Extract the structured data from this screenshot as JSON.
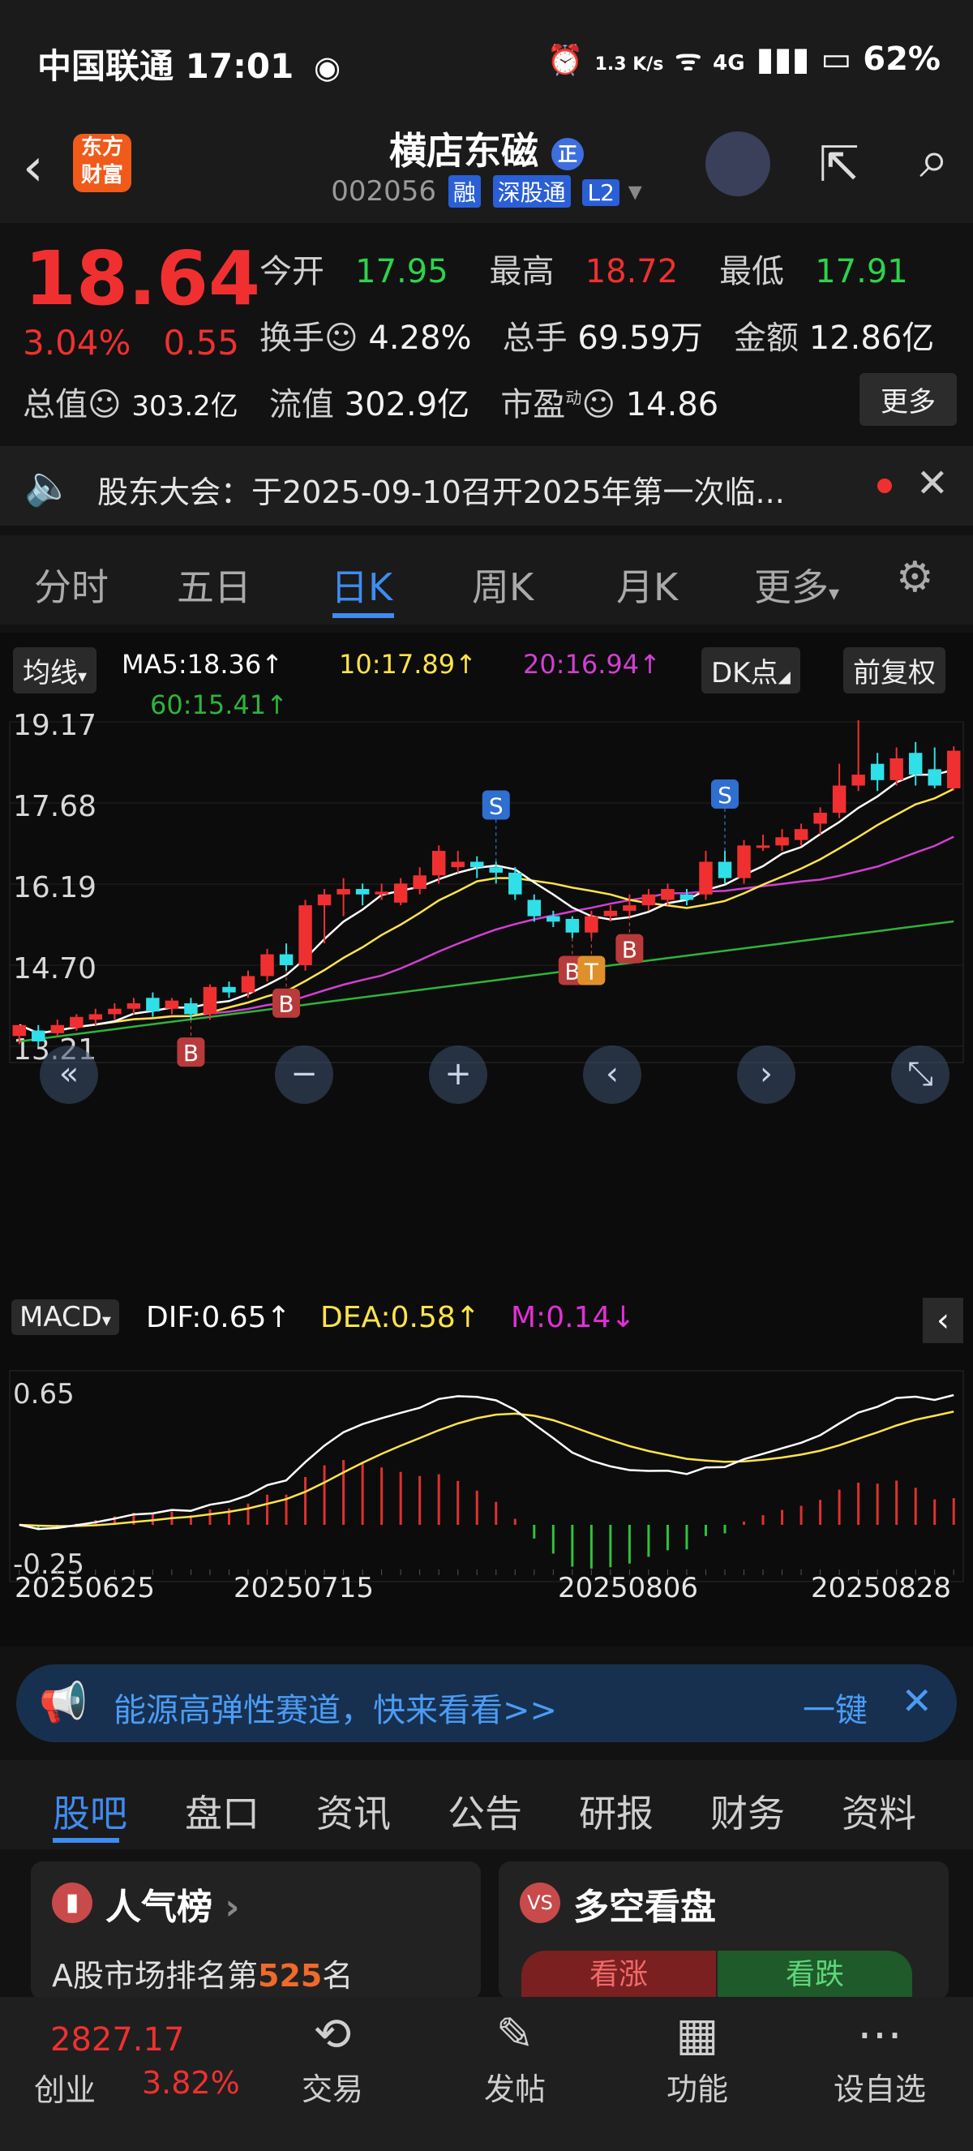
{
  "status": {
    "carrier": "中国联通",
    "time": "17:01",
    "net_speed": "1.3 K/s",
    "net_type": "4G",
    "battery": "62%"
  },
  "header": {
    "name": "横店东磁",
    "badge": "正",
    "code": "002056",
    "tags": [
      "融",
      "深股通",
      "L2"
    ],
    "logo_text": "东方财富"
  },
  "quote": {
    "price": "18.64",
    "pct": "3.04%",
    "change": "0.55",
    "open_label": "今开",
    "open": "17.95",
    "high_label": "最高",
    "high": "18.72",
    "low_label": "最低",
    "low": "17.91",
    "turnover_label": "换手",
    "turnover": "4.28%",
    "volume_label": "总手",
    "volume": "69.59万",
    "amount_label": "金额",
    "amount": "12.86亿",
    "total_cap_label": "总值",
    "total_cap": "303.2亿",
    "float_cap_label": "流值",
    "float_cap": "302.9亿",
    "pe_label": "市盈",
    "pe_sup": "动",
    "pe": "14.86",
    "more": "更多"
  },
  "notice": {
    "text": "股东大会：于2025-09-10召开2025年第一次临..."
  },
  "ktabs": [
    "分时",
    "五日",
    "日K",
    "周K",
    "月K",
    "更多"
  ],
  "ktab_active": 2,
  "chart_controls": {
    "ma_button": "均线",
    "dk_button": "DK点",
    "adjust_button": "前复权",
    "macd_button": "MACD"
  },
  "ma_legend": {
    "ma5": "MA5:18.36↑",
    "ma10": "10:17.89↑",
    "ma20": "20:16.94↑",
    "ma60": "60:15.41↑"
  },
  "macd_legend": {
    "dif": "DIF:0.65↑",
    "dea": "DEA:0.58↑",
    "m": "M:0.14↓"
  },
  "colors": {
    "up": "#f03030",
    "down": "#2fe0e8",
    "ma5": "#ffffff",
    "ma10": "#ffe34a",
    "ma20": "#d23fd2",
    "ma60": "#2fb33a",
    "accent": "#3e8cf0"
  },
  "chart_data": {
    "type": "candlestick",
    "price_axis_ticks": [
      "19.17",
      "17.68",
      "16.19",
      "14.70",
      "13.21"
    ],
    "ylim": [
      13.21,
      19.17
    ],
    "date_ticks": [
      "20250625",
      "20250715",
      "20250806",
      "20250828"
    ],
    "macd_axis_ticks": [
      "0.65",
      "-0.25"
    ],
    "candles": [
      [
        13.4,
        13.6,
        13.25,
        13.5
      ],
      [
        13.5,
        13.3,
        13.2,
        13.6
      ],
      [
        13.45,
        13.6,
        13.4,
        13.7
      ],
      [
        13.55,
        13.75,
        13.5,
        13.8
      ],
      [
        13.7,
        13.8,
        13.6,
        13.9
      ],
      [
        13.8,
        13.9,
        13.7,
        14.0
      ],
      [
        13.9,
        14.0,
        13.8,
        14.1
      ],
      [
        14.1,
        13.85,
        13.75,
        14.2
      ],
      [
        13.9,
        14.05,
        13.8,
        14.1
      ],
      [
        14.0,
        13.8,
        13.7,
        14.1
      ],
      [
        13.8,
        14.3,
        13.7,
        14.35
      ],
      [
        14.3,
        14.2,
        14.1,
        14.4
      ],
      [
        14.2,
        14.5,
        14.1,
        14.6
      ],
      [
        14.5,
        14.9,
        14.4,
        15.0
      ],
      [
        14.9,
        14.7,
        14.6,
        15.1
      ],
      [
        14.7,
        15.8,
        14.6,
        15.9
      ],
      [
        15.8,
        16.0,
        15.1,
        16.1
      ],
      [
        16.0,
        16.1,
        15.6,
        16.3
      ],
      [
        16.1,
        16.0,
        15.8,
        16.2
      ],
      [
        16.0,
        16.05,
        15.9,
        16.2
      ],
      [
        15.85,
        16.2,
        15.8,
        16.3
      ],
      [
        16.1,
        16.35,
        16.0,
        16.5
      ],
      [
        16.35,
        16.8,
        16.2,
        16.9
      ],
      [
        16.5,
        16.6,
        16.4,
        16.8
      ],
      [
        16.6,
        16.5,
        16.3,
        16.7
      ],
      [
        16.5,
        16.4,
        16.2,
        16.6
      ],
      [
        16.4,
        16.0,
        15.9,
        16.5
      ],
      [
        15.9,
        15.6,
        15.5,
        16.0
      ],
      [
        15.6,
        15.5,
        15.4,
        15.7
      ],
      [
        15.55,
        15.3,
        15.2,
        15.6
      ],
      [
        15.3,
        15.6,
        15.2,
        15.7
      ],
      [
        15.6,
        15.7,
        15.5,
        15.8
      ],
      [
        15.7,
        15.8,
        15.6,
        16.0
      ],
      [
        15.8,
        16.0,
        15.7,
        16.1
      ],
      [
        15.9,
        16.1,
        15.8,
        16.2
      ],
      [
        16.0,
        15.9,
        15.8,
        16.1
      ],
      [
        16.0,
        16.6,
        15.9,
        16.8
      ],
      [
        16.6,
        16.3,
        16.2,
        16.8
      ],
      [
        16.3,
        16.9,
        16.2,
        17.0
      ],
      [
        16.9,
        16.9,
        16.8,
        17.1
      ],
      [
        16.9,
        17.05,
        16.8,
        17.2
      ],
      [
        17.0,
        17.2,
        16.9,
        17.3
      ],
      [
        17.3,
        17.5,
        17.1,
        17.6
      ],
      [
        17.5,
        18.0,
        17.4,
        18.4
      ],
      [
        18.0,
        18.2,
        17.9,
        19.2
      ],
      [
        18.4,
        18.1,
        17.9,
        18.6
      ],
      [
        18.1,
        18.5,
        18.0,
        18.7
      ],
      [
        18.6,
        18.2,
        18.0,
        18.8
      ],
      [
        18.3,
        18.0,
        17.95,
        18.7
      ],
      [
        17.95,
        18.64,
        17.91,
        18.72
      ]
    ],
    "markers": [
      {
        "label": "B",
        "index": 9
      },
      {
        "label": "B",
        "index": 14
      },
      {
        "label": "S",
        "index": 25
      },
      {
        "label": "B",
        "index": 29
      },
      {
        "label": "T",
        "index": 30
      },
      {
        "label": "B",
        "index": 32
      },
      {
        "label": "S",
        "index": 37
      }
    ]
  },
  "ad": {
    "text": "能源高弹性赛道，快来看看>>",
    "action": "一键"
  },
  "btabs": [
    "股吧",
    "盘口",
    "资讯",
    "公告",
    "研报",
    "财务",
    "资料"
  ],
  "btab_active": 0,
  "cards": [
    {
      "title": "人气榜",
      "desc_prefix": "A股市场排名第",
      "rank": "525",
      "desc_suffix": "名"
    },
    {
      "title": "多空看盘",
      "bull": "看涨",
      "bear": "看跌"
    }
  ],
  "bottom_nav": {
    "index_value": "2827.17",
    "index_name": "创业",
    "index_pct": "3.82%",
    "items": [
      "交易",
      "发帖",
      "功能",
      "设自选"
    ]
  }
}
